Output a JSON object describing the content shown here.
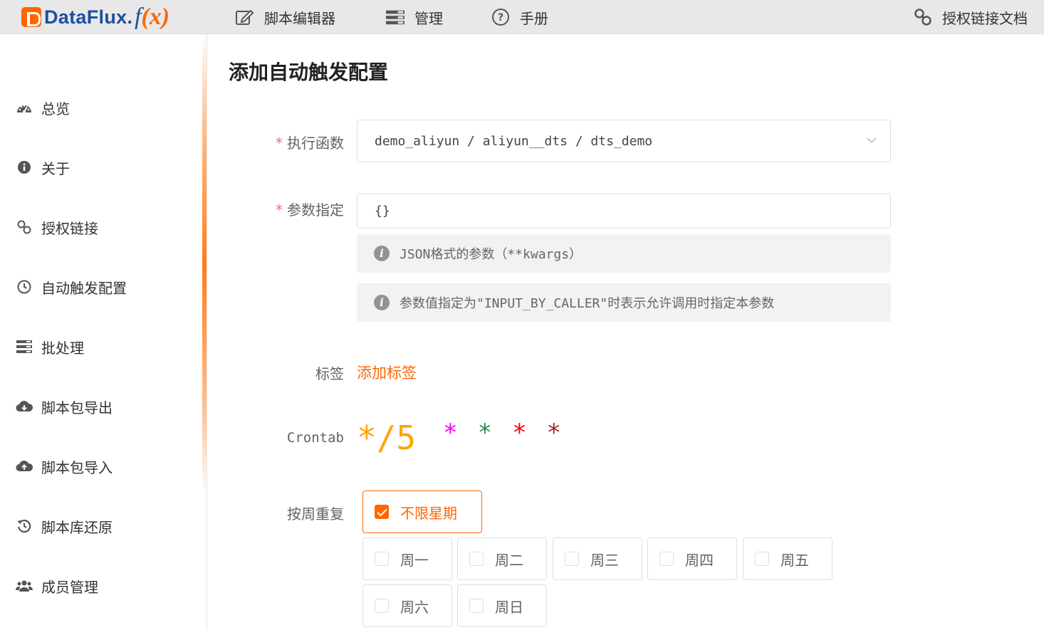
{
  "app": {
    "logo_name": "DataFlux",
    "logo_dot": ".",
    "logo_fx_f": "f",
    "logo_fx_open": "(",
    "logo_fx_x": "x",
    "logo_fx_close": ")"
  },
  "topnav": {
    "editor": "脚本编辑器",
    "manage": "管理",
    "manual": "手册",
    "auth_doc": "授权链接文档"
  },
  "sidebar": {
    "items": [
      {
        "label": "总览",
        "icon": "dashboard-icon"
      },
      {
        "label": "关于",
        "icon": "info-icon"
      },
      {
        "label": "授权链接",
        "icon": "link-icon"
      },
      {
        "label": "自动触发配置",
        "icon": "clock-icon"
      },
      {
        "label": "批处理",
        "icon": "list-icon"
      },
      {
        "label": "脚本包导出",
        "icon": "cloud-download-icon"
      },
      {
        "label": "脚本包导入",
        "icon": "cloud-upload-icon"
      },
      {
        "label": "脚本库还原",
        "icon": "history-icon"
      },
      {
        "label": "成员管理",
        "icon": "users-icon"
      }
    ]
  },
  "form": {
    "title": "添加自动触发配置",
    "required_mark": "*",
    "func_label": "执行函数",
    "func_value": "demo_aliyun / aliyun__dts / dts_demo",
    "kwargs_label": "参数指定",
    "kwargs_value": "{}",
    "hint1": "JSON格式的参数（**kwargs）",
    "hint2": "参数值指定为\"INPUT_BY_CALLER\"时表示允许调用时指定本参数",
    "tags_label": "标签",
    "add_tag": "添加标签",
    "crontab_label": "Crontab",
    "crontab_fields": [
      "*/5",
      "*",
      "*",
      "*",
      "*"
    ],
    "crontab_colors": [
      "#ffa500",
      "#ff00ff",
      "#2e8b57",
      "#ff0000",
      "#a52a2a"
    ],
    "weekday_label": "按周重复",
    "all_weekdays": "不限星期",
    "all_weekdays_checked": true,
    "weekdays": [
      "周一",
      "周二",
      "周三",
      "周四",
      "周五",
      "周六",
      "周日"
    ]
  },
  "colors": {
    "accent": "#ff6600",
    "brand_blue": "#1d4fa0"
  }
}
